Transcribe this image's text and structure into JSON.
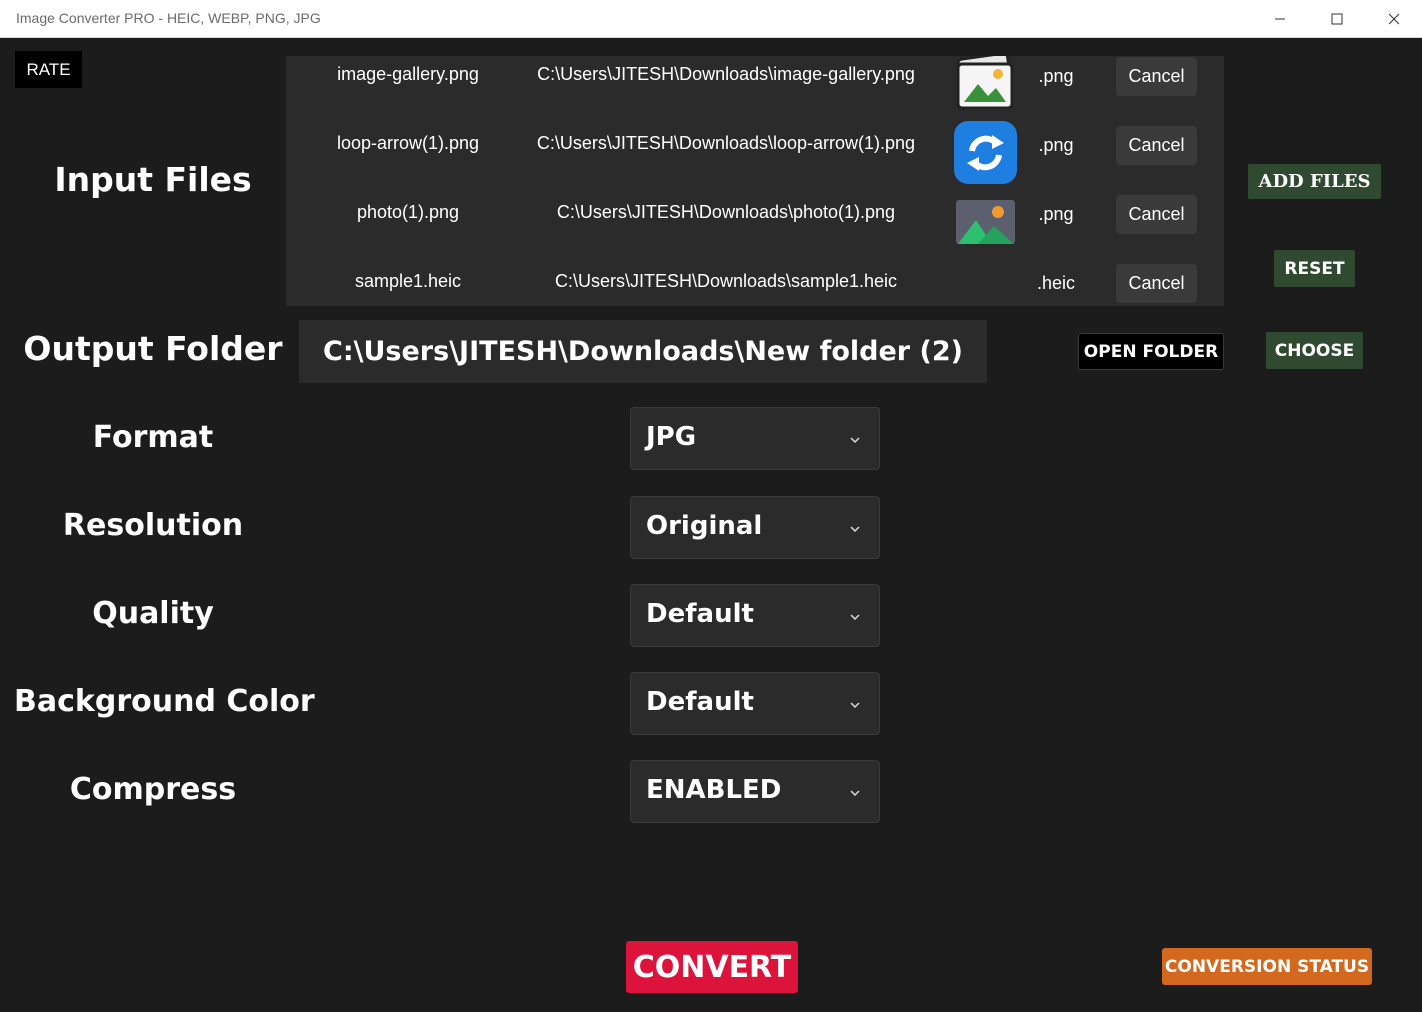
{
  "window": {
    "title": "Image Converter PRO - HEIC, WEBP, PNG, JPG"
  },
  "header": {
    "rate_label": "RATE"
  },
  "input_files": {
    "label": "Input Files",
    "files": [
      {
        "name": "image-gallery.png",
        "path": "C:\\Users\\JITESH\\Downloads\\image-gallery.png",
        "ext": ".png",
        "thumb_icon": "image-gallery-icon",
        "cancel_label": "Cancel"
      },
      {
        "name": "loop-arrow(1).png",
        "path": "C:\\Users\\JITESH\\Downloads\\loop-arrow(1).png",
        "ext": ".png",
        "thumb_icon": "loop-arrow-icon",
        "cancel_label": "Cancel"
      },
      {
        "name": "photo(1).png",
        "path": "C:\\Users\\JITESH\\Downloads\\photo(1).png",
        "ext": ".png",
        "thumb_icon": "photo-icon",
        "cancel_label": "Cancel"
      },
      {
        "name": "sample1.heic",
        "path": "C:\\Users\\JITESH\\Downloads\\sample1.heic",
        "ext": ".heic",
        "thumb_icon": "",
        "cancel_label": "Cancel"
      }
    ],
    "add_files_label": "ADD FILES",
    "reset_label": "RESET"
  },
  "output_folder": {
    "label": "Output Folder",
    "path": "C:\\Users\\JITESH\\Downloads\\New folder (2)",
    "open_folder_label": "OPEN FOLDER",
    "choose_label": "CHOOSE"
  },
  "settings": {
    "format": {
      "label": "Format",
      "value": "JPG"
    },
    "resolution": {
      "label": "Resolution",
      "value": "Original"
    },
    "quality": {
      "label": "Quality",
      "value": "Default"
    },
    "background_color": {
      "label": "Background Color",
      "value": "Default"
    },
    "compress": {
      "label": "Compress",
      "value": "ENABLED"
    }
  },
  "footer": {
    "convert_label": "CONVERT",
    "status_label": "CONVERSION STATUS"
  },
  "colors": {
    "background": "#1c1c1c",
    "panel": "#2b2b2b",
    "green_button": "#2f4a31",
    "convert": "#dc143c",
    "status": "#d2691e"
  }
}
